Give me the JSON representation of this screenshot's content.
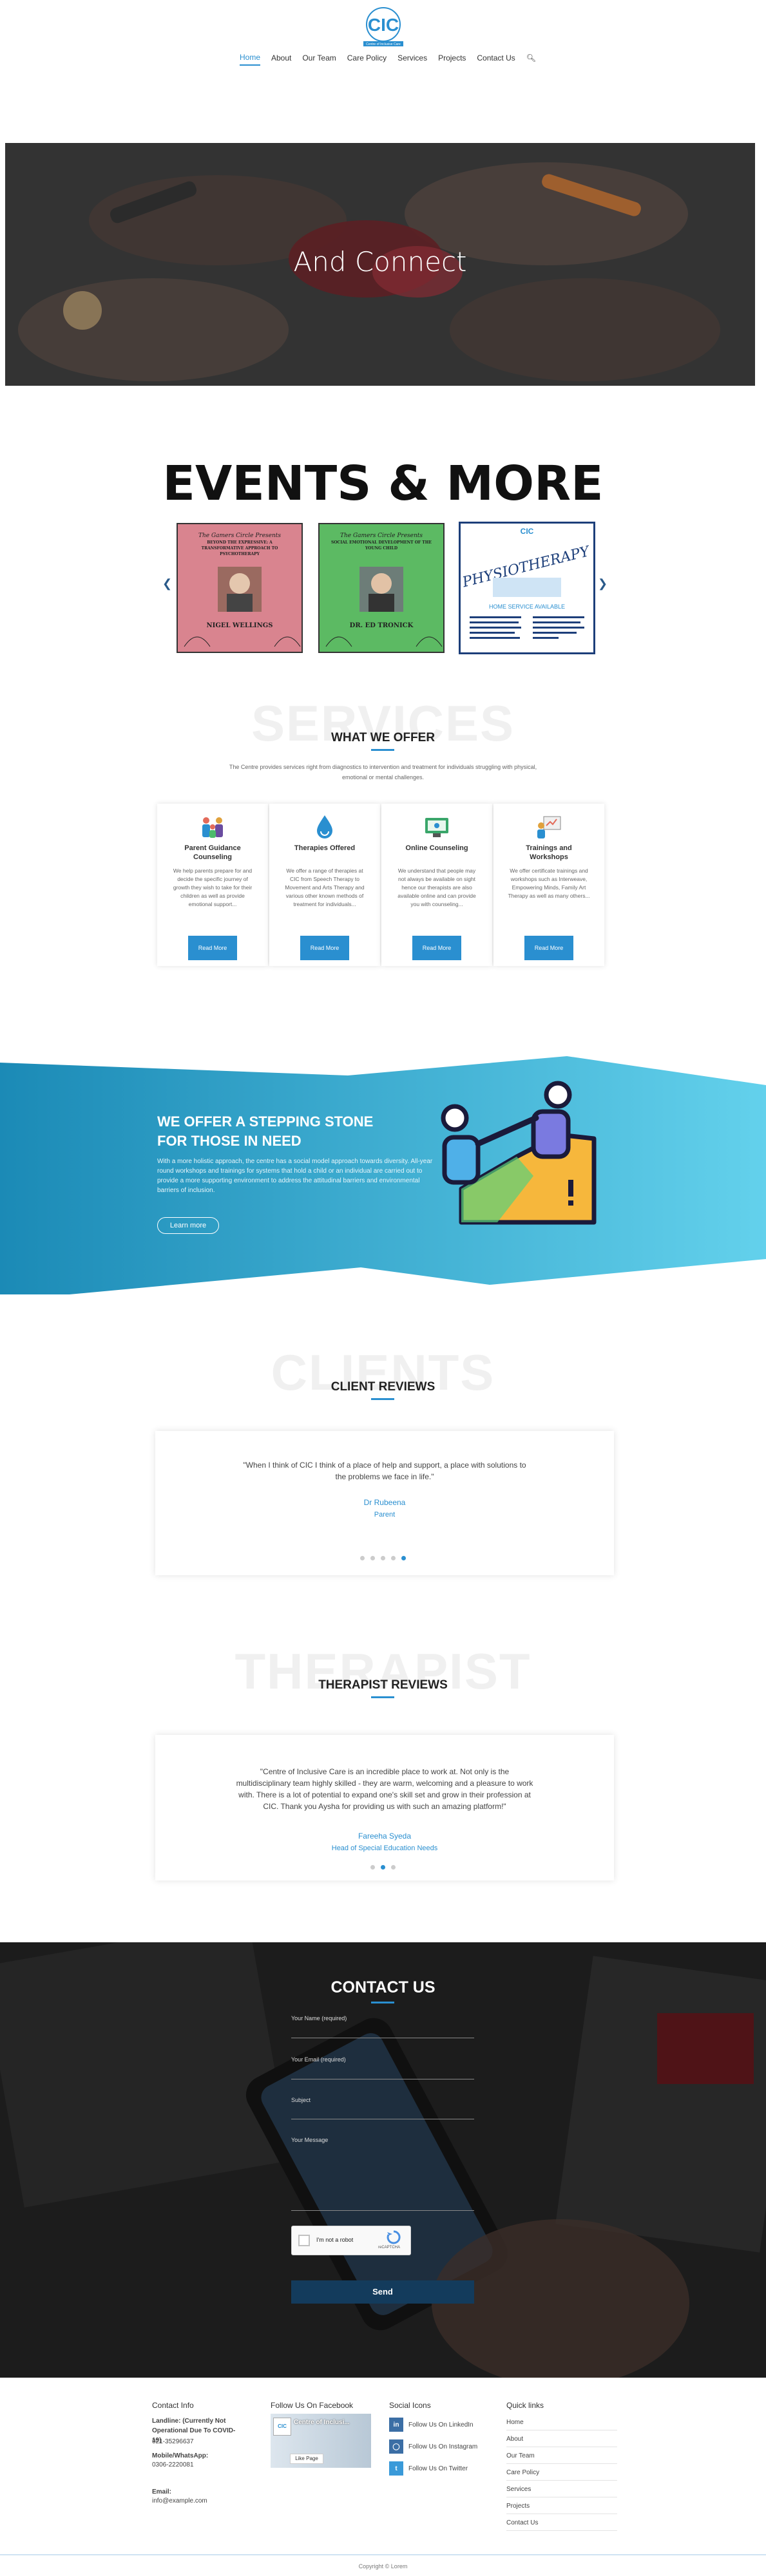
{
  "header": {
    "logo_text": "CIC",
    "logo_sub": "Centre of Inclusive Care",
    "nav": [
      "Home",
      "About",
      "Our Team",
      "Care Policy",
      "Services",
      "Projects",
      "Contact Us"
    ]
  },
  "hero": {
    "title": "And Connect"
  },
  "events": {
    "title": "EVENTS & MORE",
    "posters": [
      {
        "header": "The Gamers Circle Presents",
        "title": "BEYOND THE EXPRESSIVE: A TRANSFORMATIVE APPROACH TO PSYCHOTHERAPY",
        "name": "NIGEL WELLINGS",
        "bg": "#d9848f"
      },
      {
        "header": "The Gamers Circle Presents",
        "title": "SOCIAL EMOTIONAL DEVELOPMENT OF THE YOUNG CHILD",
        "name": "DR. ED TRONICK",
        "bg": "#5cba63"
      },
      {
        "header": "CIC",
        "title": "PHYSIOTHERAPY",
        "sub": "HOME SERVICE AVAILABLE",
        "bg": "#ffffff"
      }
    ]
  },
  "services": {
    "ghost": "SERVICES",
    "title": "WHAT WE OFFER",
    "description": "The Centre provides services right from diagnostics to intervention and treatment for individuals struggling with physical, emotional or mental challenges.",
    "cards": [
      {
        "title": "Parent Guidance Counseling",
        "text": "We help parents prepare for and decide the specific journey of growth they wish to take for their children as well as provide emotional support...",
        "button": "Read More"
      },
      {
        "title": "Therapies Offered",
        "text": "We offer a range of therapies at CIC from Speech Therapy to Movement and Arts Therapy and various other known methods of treatment for individuals...",
        "button": "Read More"
      },
      {
        "title": "Online Counseling",
        "text": "We understand that people may not always be available on sight hence our therapists are also available online and can provide you with counseling...",
        "button": "Read More"
      },
      {
        "title": "Trainings and Workshops",
        "text": "We offer certificate trainings and workshops such as Interweave, Empowering Minds, Family Art Therapy as well as many others...",
        "button": "Read More"
      }
    ]
  },
  "stepping": {
    "title": "WE OFFER A STEPPING STONE FOR THOSE IN NEED",
    "text": "With a more holistic approach, the centre has a social model approach towards diversity. All-year round workshops and trainings for systems that hold a child or an individual are carried out to provide a more supporting environment to address the attitudinal barriers and environmental barriers of inclusion.",
    "button": "Learn more"
  },
  "clients": {
    "ghost": "CLIENTS",
    "title": "CLIENT REVIEWS",
    "quote": "\"When I think of CIC I think of a place of help and support, a place with solutions to the problems we face in life.\"",
    "name": "Dr Rubeena",
    "role": "Parent"
  },
  "therapists": {
    "ghost": "THERAPIST",
    "title": "THERAPIST REVIEWS",
    "quote": "\"Centre of Inclusive Care is an incredible place to work at. Not only is the multidisciplinary team highly skilled - they are warm, welcoming and a pleasure to work with. There is a lot of potential to expand one's skill set and grow in their profession at CIC. Thank you Aysha for providing us with such an amazing platform!\"",
    "name": "Fareeha Syeda",
    "role": "Head of Special Education Needs"
  },
  "contact": {
    "title": "CONTACT US",
    "fields": [
      "Your Name (required)",
      "Your Email (required)",
      "Subject",
      "Your Message"
    ],
    "captcha": "I'm not a robot",
    "captcha_brand": "reCAPTCHA",
    "send": "Send"
  },
  "footer": {
    "contact_title": "Contact Info",
    "landline_label": "Landline: (Currently Not Operational Due To COVID-19)",
    "landline": "021-35296637",
    "mobile_label": "Mobile/WhatsApp:",
    "mobile": "0306-2220081",
    "email_label": "Email:",
    "email": "info@example.com",
    "facebook_title": "Follow Us On Facebook",
    "facebook_page": "Centre of Inclusi...",
    "facebook_likes": "Like Page",
    "social_title": "Social Icons",
    "social": [
      "Follow Us On LinkedIn",
      "Follow Us On Instagram",
      "Follow Us On Twitter"
    ],
    "quick_title": "Quick links",
    "quick": [
      "Home",
      "About",
      "Our Team",
      "Care Policy",
      "Services",
      "Projects",
      "Contact Us"
    ],
    "copyright": "Copyright © Lorem"
  }
}
